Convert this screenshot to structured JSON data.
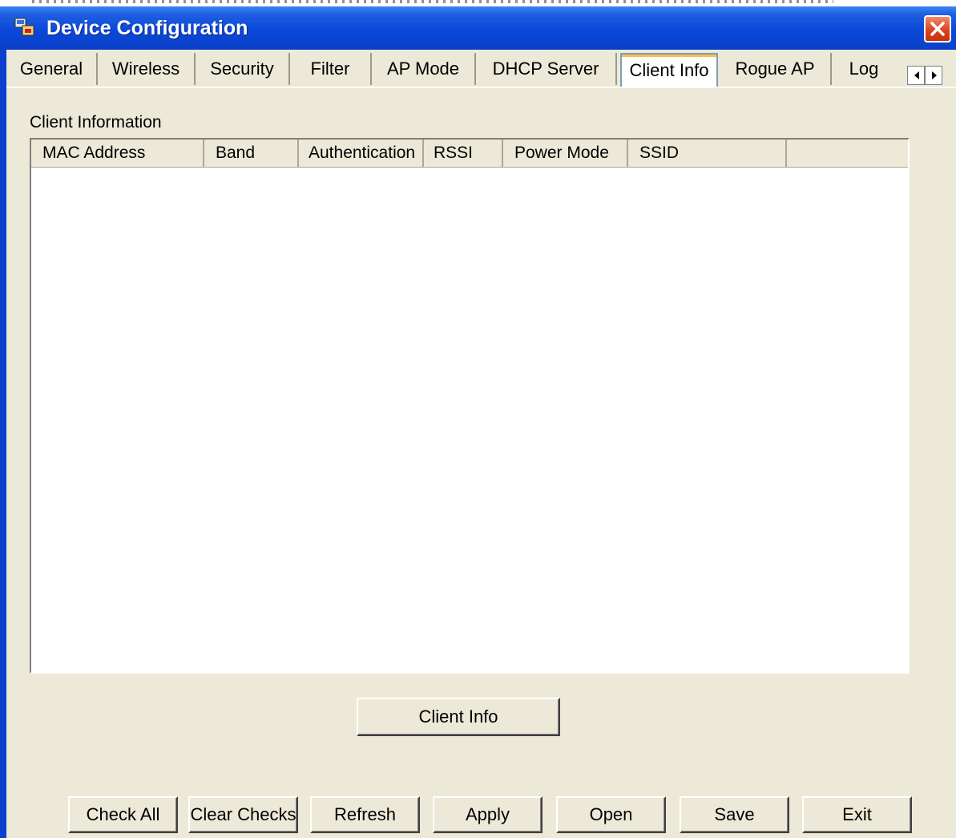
{
  "window": {
    "title": "Device Configuration",
    "icon": "device-config-icon",
    "close_icon": "close-icon"
  },
  "tabs": [
    {
      "label": "General",
      "active": false
    },
    {
      "label": "Wireless",
      "active": false
    },
    {
      "label": "Security",
      "active": false
    },
    {
      "label": "Filter",
      "active": false
    },
    {
      "label": "AP Mode",
      "active": false
    },
    {
      "label": "DHCP Server",
      "active": false
    },
    {
      "label": "Client Info",
      "active": true
    },
    {
      "label": "Rogue AP",
      "active": false
    },
    {
      "label": "Log",
      "active": false
    }
  ],
  "tab_scroll": {
    "left_icon": "arrow-left-icon",
    "right_icon": "arrow-right-icon"
  },
  "client_info": {
    "section_label": "Client Information",
    "columns": [
      "MAC Address",
      "Band",
      "Authentication",
      "RSSI",
      "Power Mode",
      "SSID"
    ],
    "rows": [],
    "button_label": "Client Info"
  },
  "footer_buttons": [
    "Check All",
    "Clear Checks",
    "Refresh",
    "Apply",
    "Open",
    "Save",
    "Exit"
  ],
  "colors": {
    "titlebar": "#0A48D8",
    "window_bg": "#ECE9D8",
    "close_button": "#D9401C",
    "active_tab_highlight": "#F5C04A"
  }
}
